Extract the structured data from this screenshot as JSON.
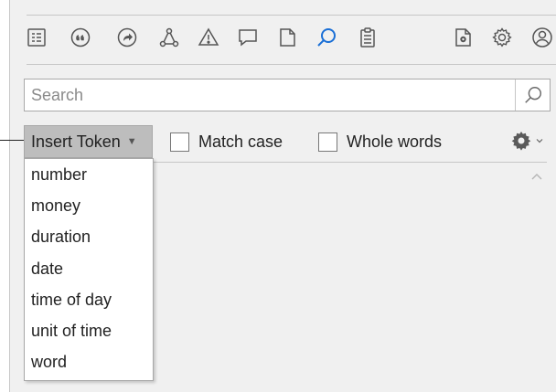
{
  "toolbar": {
    "icons": [
      "document-list-icon",
      "quote-icon",
      "share-icon",
      "network-icon",
      "warning-icon",
      "comment-icon",
      "page-icon",
      "search-icon",
      "clipboard-icon",
      "document-settings-icon",
      "gear-icon",
      "user-icon"
    ],
    "active_icon": "search-icon",
    "accent_color": "#1a6fd6"
  },
  "search": {
    "placeholder": "Search",
    "value": ""
  },
  "options": {
    "insert_token_label": "Insert Token",
    "match_case_label": "Match case",
    "match_case_checked": false,
    "whole_words_label": "Whole words",
    "whole_words_checked": false
  },
  "token_menu": {
    "items": [
      "number",
      "money",
      "duration",
      "date",
      "time of day",
      "unit of time",
      "word"
    ]
  }
}
